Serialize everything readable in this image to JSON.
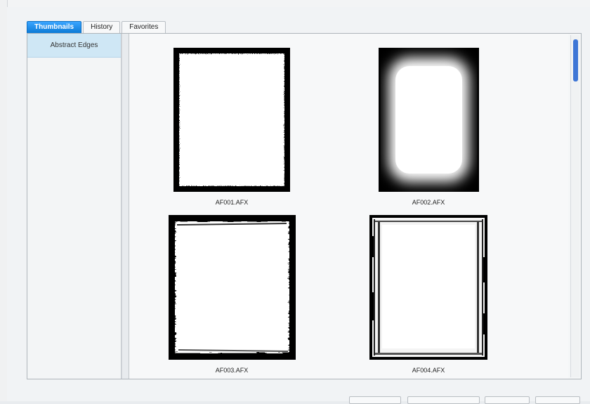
{
  "tabs": [
    {
      "label": "Thumbnails",
      "active": true
    },
    {
      "label": "History",
      "active": false
    },
    {
      "label": "Favorites",
      "active": false
    }
  ],
  "sidebar": {
    "items": [
      {
        "label": "Abstract Edges",
        "selected": true
      }
    ]
  },
  "thumbnails": [
    {
      "caption": "AF001.AFX",
      "style": "rough-thin-border"
    },
    {
      "caption": "AF002.AFX",
      "style": "soft-vignette"
    },
    {
      "caption": "AF003.AFX",
      "style": "brush-border"
    },
    {
      "caption": "AF004.AFX",
      "style": "film-edge"
    }
  ],
  "colors": {
    "tab_active": "#0c7ad6",
    "sidebar_selected": "#cfe7f5",
    "scroll_thumb": "#3e76d6"
  }
}
